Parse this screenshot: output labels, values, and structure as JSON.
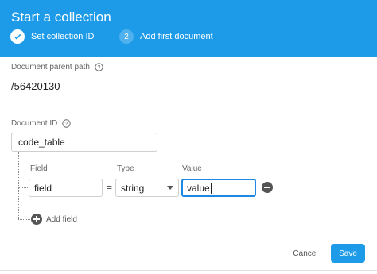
{
  "header": {
    "title": "Start a collection",
    "steps": [
      {
        "label": "Set collection ID",
        "status": "done",
        "icon": "check-icon"
      },
      {
        "number": "2",
        "label": "Add first document",
        "status": "current"
      }
    ]
  },
  "form": {
    "parent_path_label": "Document parent path",
    "parent_path_value": "/56420130",
    "document_id_label": "Document ID",
    "document_id_value": "code_table",
    "columns": {
      "field": "Field",
      "type": "Type",
      "value": "Value"
    },
    "row": {
      "field": "field",
      "equals": "=",
      "type": "string",
      "value": "value"
    },
    "add_field_label": "Add field"
  },
  "footer": {
    "cancel_label": "Cancel",
    "save_label": "Save"
  },
  "colors": {
    "accent": "#1e9be8",
    "focus_border": "#1e88e5"
  }
}
